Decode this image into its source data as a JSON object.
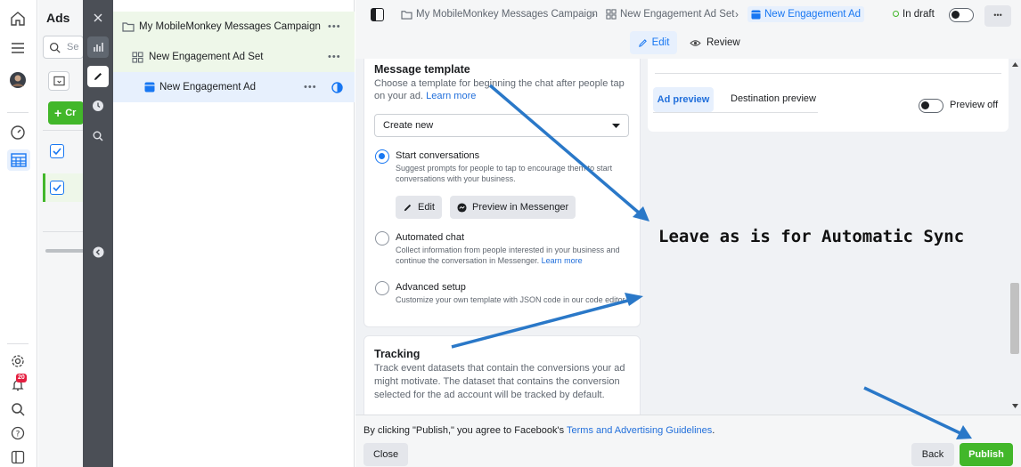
{
  "ads_panel": {
    "title": "Ads",
    "search_placeholder": "Se",
    "create_label": "Cr"
  },
  "rail": {
    "notification_count": "20"
  },
  "tree": {
    "campaign": "My MobileMonkey Messages Campaign",
    "ad_set": "New Engagement Ad Set",
    "ad": "New Engagement Ad",
    "more": "•••"
  },
  "topbar": {
    "crumb_campaign": "My MobileMonkey Messages Campaign",
    "crumb_adset": "New Engagement Ad Set",
    "crumb_ad": "New Engagement Ad",
    "status": "In draft",
    "edit_tab": "Edit",
    "review_tab": "Review",
    "more": "•••"
  },
  "message_template": {
    "heading": "Message template",
    "description": "Choose a template for beginning the chat after people tap on your ad.",
    "learn_more": "Learn more",
    "select_value": "Create new",
    "options": [
      {
        "label": "Start conversations",
        "desc": "Suggest prompts for people to tap to encourage them to start conversations with your business.",
        "selected": true
      },
      {
        "label": "Automated chat",
        "desc": "Collect information from people interested in your business and continue the conversation in Messenger.",
        "link": "Learn more",
        "selected": false
      },
      {
        "label": "Advanced setup",
        "desc": "Customize your own template with JSON code in our code editor.",
        "selected": false
      }
    ],
    "edit_button": "Edit",
    "preview_button": "Preview in Messenger"
  },
  "tracking": {
    "heading": "Tracking",
    "description": "Track event datasets that contain the conversions your ad might motivate. The dataset that contains the conversion selected for the ad account will be tracked by default."
  },
  "preview": {
    "tab_ad_preview": "Ad preview",
    "tab_destination": "Destination preview",
    "preview_off": "Preview off"
  },
  "annotation": {
    "text": "Leave as is for Automatic Sync"
  },
  "footer": {
    "notice_prefix": "By clicking \"Publish,\" you agree to Facebook's",
    "notice_link": "Terms and Advertising Guidelines",
    "notice_suffix": ".",
    "close": "Close",
    "back": "Back",
    "publish": "Publish"
  },
  "colors": {
    "accent": "#1877f2",
    "publish": "#42b72a",
    "arrow": "#2a78c8",
    "strip": "#4b4f56"
  }
}
